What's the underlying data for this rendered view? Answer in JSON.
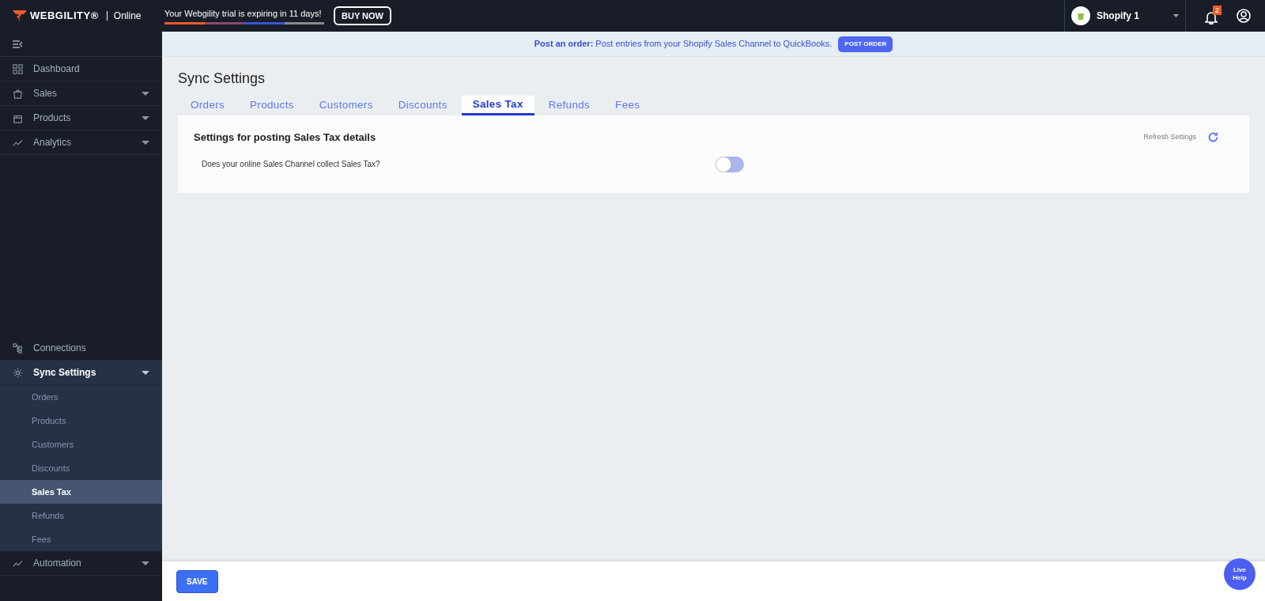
{
  "header": {
    "brand": "WEBGILITY®",
    "edition": "Online",
    "trial_text": "Your Webgility trial is expiring in 11 days!",
    "buy_button": "BUY NOW",
    "store": "Shopify 1",
    "notification_count": "2"
  },
  "sidebar": {
    "top_items": [
      {
        "label": "Dashboard",
        "selected": false
      },
      {
        "label": "Sales",
        "selected": false,
        "expanded": false
      },
      {
        "label": "Products",
        "selected": false,
        "expanded": false
      },
      {
        "label": "Analytics",
        "selected": false,
        "expanded": false
      }
    ],
    "bottom_items": [
      {
        "label": "Connections",
        "selected": false
      },
      {
        "label": "Sync Settings",
        "selected": true,
        "expanded": true,
        "children": [
          {
            "label": "Orders",
            "selected": false
          },
          {
            "label": "Products",
            "selected": false
          },
          {
            "label": "Customers",
            "selected": false
          },
          {
            "label": "Discounts",
            "selected": false
          },
          {
            "label": "Sales Tax",
            "selected": true
          },
          {
            "label": "Refunds",
            "selected": false
          },
          {
            "label": "Fees",
            "selected": false
          }
        ]
      },
      {
        "label": "Automation",
        "selected": false,
        "expanded": false
      }
    ]
  },
  "banner": {
    "text": "**Post an order:** Post entries from your Shopify Sales Channel to QuickBooks.",
    "button": "POST ORDER"
  },
  "page_title": "Sync Settings",
  "tabs": [
    {
      "label": "Orders",
      "selected": false
    },
    {
      "label": "Products",
      "selected": false
    },
    {
      "label": "Customers",
      "selected": false
    },
    {
      "label": "Discounts",
      "selected": false
    },
    {
      "label": "Sales Tax",
      "selected": true
    },
    {
      "label": "Refunds",
      "selected": false
    },
    {
      "label": "Fees",
      "selected": false
    }
  ],
  "card": {
    "title": "Settings for posting Sales Tax details",
    "refresh": "Refresh Settings",
    "settings": [
      {
        "label": "Does your online Sales Channel collect Sales Tax?",
        "on": false
      }
    ]
  },
  "footer": {
    "save_button": "SAVE",
    "live_help": "Live Help"
  }
}
